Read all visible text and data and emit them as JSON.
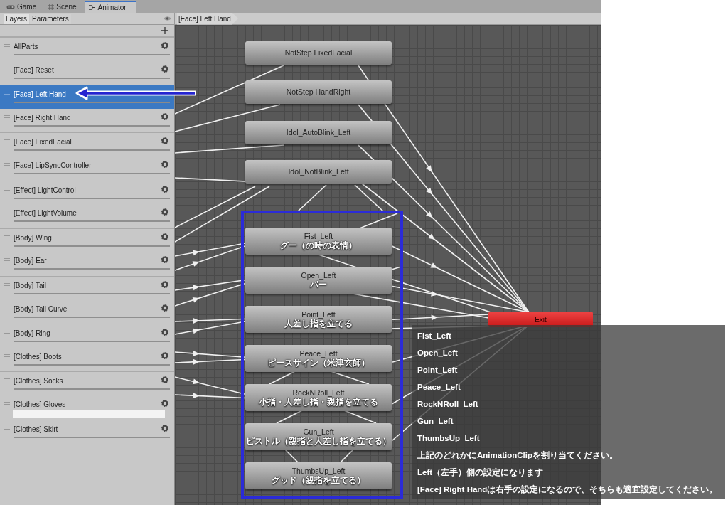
{
  "editor_tabs": [
    {
      "label": "Game",
      "kind": "game",
      "selected": false
    },
    {
      "label": "Scene",
      "kind": "scene",
      "selected": false
    },
    {
      "label": "Animator",
      "kind": "animator",
      "selected": true
    }
  ],
  "layers_panel": {
    "tabs": [
      {
        "label": "Layers",
        "selected": true
      },
      {
        "label": "Parameters",
        "selected": false
      }
    ],
    "layers": [
      {
        "name": "AllParts",
        "selected": false,
        "editing": false
      },
      {
        "name": "[Face] Reset",
        "selected": false,
        "editing": false
      },
      {
        "name": "[Face] Left Hand",
        "selected": true,
        "editing": false
      },
      {
        "name": "[Face] Right Hand",
        "selected": false,
        "editing": false
      },
      {
        "name": "[Face] FixedFacial",
        "selected": false,
        "editing": false
      },
      {
        "name": "[Face] LipSyncController",
        "selected": false,
        "editing": false
      },
      {
        "name": "[Effect] LightControl",
        "selected": false,
        "editing": false
      },
      {
        "name": "[Effect] LightVolume",
        "selected": false,
        "editing": false
      },
      {
        "name": "[Body] Wing",
        "selected": false,
        "editing": false
      },
      {
        "name": "[Body] Ear",
        "selected": false,
        "editing": false
      },
      {
        "name": "[Body] Tail",
        "selected": false,
        "editing": false
      },
      {
        "name": "[Body] Tail Curve",
        "selected": false,
        "editing": false
      },
      {
        "name": "[Body] Ring",
        "selected": false,
        "editing": false
      },
      {
        "name": "[Clothes] Boots",
        "selected": false,
        "editing": false
      },
      {
        "name": "[Clothes] Socks",
        "selected": false,
        "editing": false
      },
      {
        "name": "[Clothes] Gloves",
        "selected": false,
        "editing": true
      },
      {
        "name": "[Clothes] Skirt",
        "selected": false,
        "editing": false
      }
    ]
  },
  "breadcrumb": "[Face] Left Hand",
  "graph": {
    "states": [
      {
        "name": "NotStep FixedFacial"
      },
      {
        "name": "NotStep HandRight"
      },
      {
        "name": "Idol_AutoBlink_Left"
      },
      {
        "name": "Idol_NotBlink_Left"
      },
      {
        "name": "Fist_Left",
        "note": "グー（の時の表情）"
      },
      {
        "name": "Open_Left",
        "note": "パー"
      },
      {
        "name": "Point_Left",
        "note": "人差し指を立てる"
      },
      {
        "name": "Peace_Left",
        "note": "ピースサイン（米津玄師）"
      },
      {
        "name": "RockNRoll_Left",
        "note": "小指・人差し指・親指を立てる"
      },
      {
        "name": "Gun_Left",
        "note": "ピストル（親指と人差し指を立てる）"
      },
      {
        "name": "ThumbsUp_Left",
        "note": "グッド（親指を立てる）"
      }
    ],
    "exit": "Exit"
  },
  "annotation": {
    "lines": [
      "Fist_Left",
      "Open_Left",
      "Point_Left",
      "Peace_Left",
      "RockNRoll_Left",
      "Gun_Left",
      "ThumbsUp_Left",
      "上記のどれかにAnimationClipを割り当てください。",
      "Left（左手）側の設定になります",
      "[Face] Right Handは右手の設定になるので、そちらも適宜設定してください。"
    ]
  }
}
